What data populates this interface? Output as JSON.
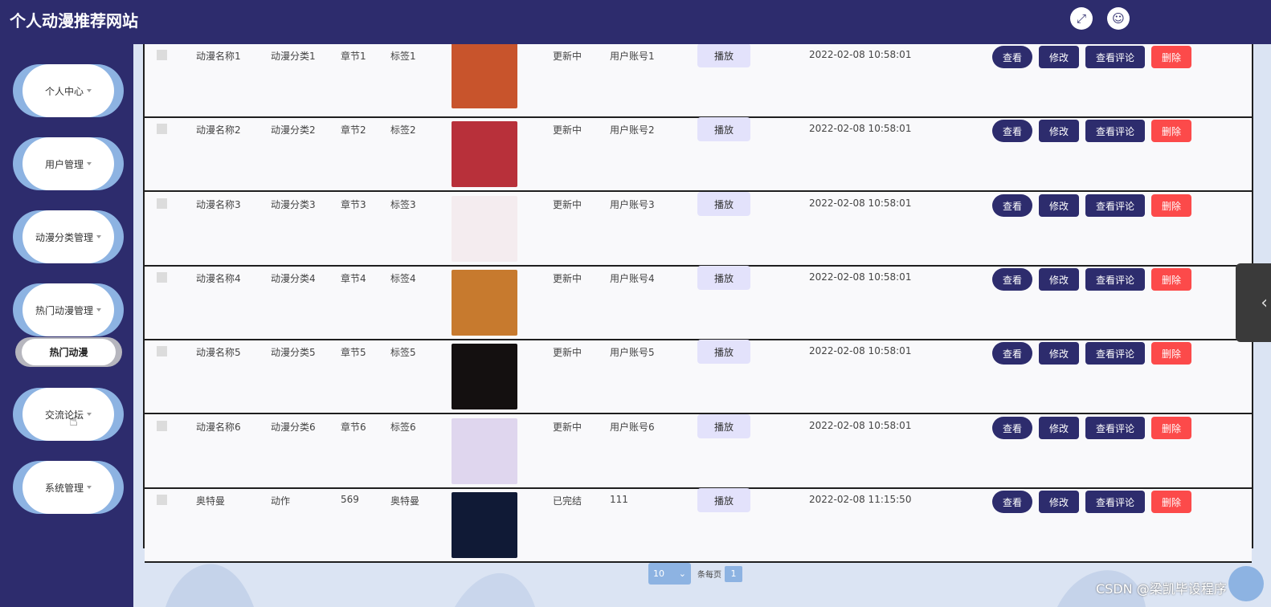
{
  "header": {
    "title": "个人动漫推荐网站",
    "fullscreen_icon": "expand-icon",
    "user_icon": "user-icon"
  },
  "sidebar": {
    "items": [
      {
        "label": "个人中心"
      },
      {
        "label": "用户管理"
      },
      {
        "label": "动漫分类管理"
      },
      {
        "label": "热门动漫管理"
      },
      {
        "label": "交流论坛"
      },
      {
        "label": "系统管理"
      }
    ],
    "active_submenu": "热门动漫"
  },
  "table": {
    "play_label": "播放",
    "actions": {
      "view": "查看",
      "edit": "修改",
      "comments": "查看评论",
      "delete": "删除"
    },
    "rows": [
      {
        "name": "动漫名称1",
        "category": "动漫分类1",
        "chapter": "章节1",
        "tag": "标签1",
        "status": "更新中",
        "account": "用户账号1",
        "time": "2022-02-08 10:58:01",
        "thumb_color": "#c8542c"
      },
      {
        "name": "动漫名称2",
        "category": "动漫分类2",
        "chapter": "章节2",
        "tag": "标签2",
        "status": "更新中",
        "account": "用户账号2",
        "time": "2022-02-08 10:58:01",
        "thumb_color": "#b8303a"
      },
      {
        "name": "动漫名称3",
        "category": "动漫分类3",
        "chapter": "章节3",
        "tag": "标签3",
        "status": "更新中",
        "account": "用户账号3",
        "time": "2022-02-08 10:58:01",
        "thumb_color": "#f4ecef"
      },
      {
        "name": "动漫名称4",
        "category": "动漫分类4",
        "chapter": "章节4",
        "tag": "标签4",
        "status": "更新中",
        "account": "用户账号4",
        "time": "2022-02-08 10:58:01",
        "thumb_color": "#c77a2e"
      },
      {
        "name": "动漫名称5",
        "category": "动漫分类5",
        "chapter": "章节5",
        "tag": "标签5",
        "status": "更新中",
        "account": "用户账号5",
        "time": "2022-02-08 10:58:01",
        "thumb_color": "#141010"
      },
      {
        "name": "动漫名称6",
        "category": "动漫分类6",
        "chapter": "章节6",
        "tag": "标签6",
        "status": "更新中",
        "account": "用户账号6",
        "time": "2022-02-08 10:58:01",
        "thumb_color": "#dfd6ee"
      },
      {
        "name": "奥特曼",
        "category": "动作",
        "chapter": "569",
        "tag": "奥特曼",
        "status": "已完结",
        "account": "111",
        "time": "2022-02-08 11:15:50",
        "thumb_color": "#101a36"
      }
    ]
  },
  "pagination": {
    "page_size": "10",
    "per_page_label": "条每页",
    "current_page": "1"
  },
  "watermark": "CSDN @梁凯毕设程序",
  "colors": {
    "primary": "#2d2c6d",
    "danger": "#fc4a4a",
    "accent": "#8db3e2"
  }
}
